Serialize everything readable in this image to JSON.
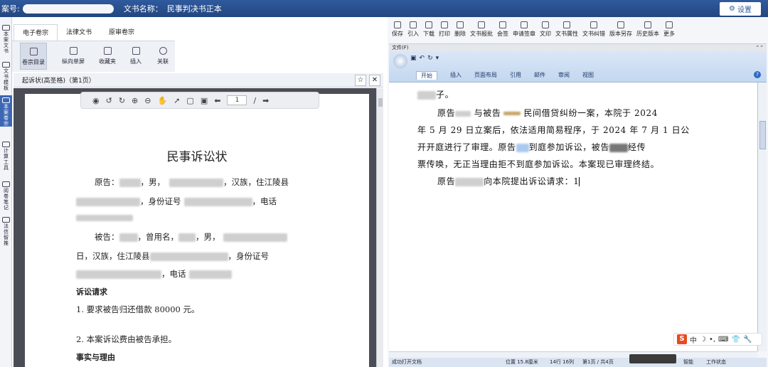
{
  "topbar": {
    "case_label": "案号:",
    "doc_label": "文书名称：",
    "doc_name": "民事判决书正本",
    "settings_label": "设置"
  },
  "leftnav": [
    {
      "label": "本案文书"
    },
    {
      "label": "文书模板"
    },
    {
      "label": "本案卷宗"
    },
    {
      "label": "计算工具"
    },
    {
      "label": "阅卷笔记"
    },
    {
      "label": "法信智推"
    }
  ],
  "lefttabs": [
    "电子卷宗",
    "法律文书",
    "原审卷宗"
  ],
  "lefttools": [
    "卷宗目录",
    "纵向单屏",
    "收藏夹",
    "插入",
    "关联"
  ],
  "pdf": {
    "header_title": "起诉状(高圣格)（第1页）",
    "page_current": "1",
    "page_sep": "/",
    "title": "民事诉讼状",
    "lines": [
      "原告：",
      "，男，",
      "，汉族，住江陵县",
      "，身份证号",
      "，电话",
      "被告：",
      "，曾用名，",
      "，男，",
      "日，汉族，住江陵县",
      "，身份证号",
      "，电话"
    ],
    "h1": "诉讼请求",
    "claim1": "1. 要求被告归还借款 80000 元。",
    "claim2": "2.   本案诉讼费由被告承担。",
    "h2": "事实与理由"
  },
  "right": {
    "tools": [
      "保存",
      "引入",
      "下载",
      "打印",
      "删除",
      "文书报批",
      "会签",
      "申请签章",
      "文印",
      "文书属性",
      "文书纠错",
      "版本另存",
      "历史版本",
      "更多"
    ],
    "filebar": "文件(F)",
    "word_tabs": [
      "开始",
      "插入",
      "页面布局",
      "引用",
      "邮件",
      "审阅",
      "视图"
    ],
    "body": {
      "l0": "子。",
      "l1a": "原告",
      "l1b": "与被告",
      "l1c": "民间借贷纠纷一案，本院于 2024",
      "l2": "年 5 月 29 日立案后，依法适用简易程序，于 2024 年 7 月 1 日公",
      "l3a": "开开庭进行了审理。原告",
      "l3b": "到庭参加诉讼，被告",
      "l3c": "经传",
      "l4": "票传唤，无正当理由拒不到庭参加诉讼。本案现已审理终结。",
      "l5a": "原告",
      "l5b": "向本院提出诉讼请求：1"
    },
    "status": {
      "left": "成功打开文档",
      "pos": "位置 15.8厘米",
      "rowcol": "14行 16列",
      "page": "第1页 / 共4页",
      "mode": "智能",
      "state": "工作状态"
    },
    "ime": "中"
  }
}
